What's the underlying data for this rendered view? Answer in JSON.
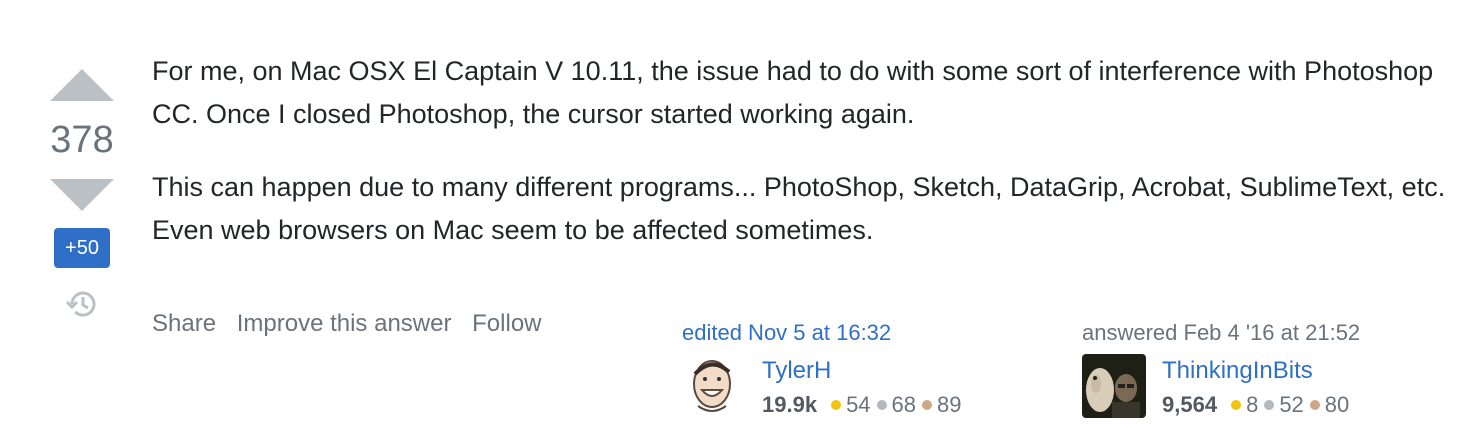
{
  "vote": {
    "score": "378",
    "bounty": "+50"
  },
  "post": {
    "paragraphs": [
      "For me, on Mac OSX El Captain V 10.11, the issue had to do with some sort of interference with Photoshop CC. Once I closed Photoshop, the cursor started working again.",
      "This can happen due to many different programs... PhotoShop, Sketch, DataGrip, Acrobat, SublimeText, etc. Even web browsers on Mac seem to be affected sometimes."
    ]
  },
  "menu": {
    "share": "Share",
    "improve": "Improve this answer",
    "follow": "Follow"
  },
  "editor": {
    "action": "edited Nov 5 at 16:32",
    "name": "TylerH",
    "reputation": "19.9k",
    "gold": "54",
    "silver": "68",
    "bronze": "89"
  },
  "author": {
    "action": "answered Feb 4 '16 at 21:52",
    "name": "ThinkingInBits",
    "reputation": "9,564",
    "gold": "8",
    "silver": "52",
    "bronze": "80"
  },
  "colors": {
    "link": "#2f6fc8",
    "muted": "#6a737c",
    "vote_arrow": "#bbc0c4",
    "bounty_bg": "#2f6fc8"
  },
  "icons": {
    "upvote": "triangle-up-icon",
    "downvote": "triangle-down-icon",
    "history": "history-icon"
  }
}
